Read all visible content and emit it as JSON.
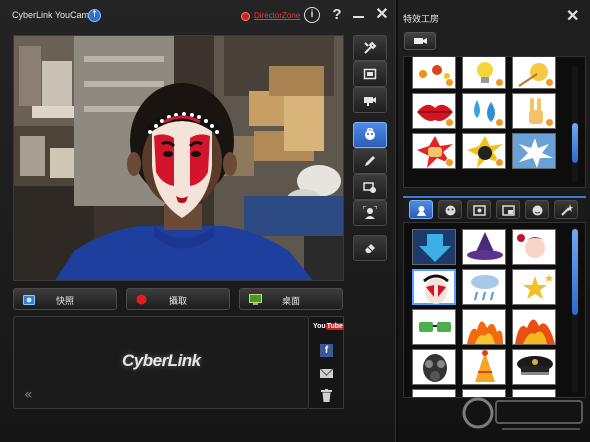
{
  "window": {
    "app_title": "CyberLink YouCam",
    "director_zone": "DirectorZone",
    "help_glyph": "?",
    "info_glyph": "i",
    "close_glyph": "✕"
  },
  "toolbar": {
    "icons": [
      "tools-icon",
      "fullscreen-icon",
      "camera-settings-icon",
      "avatar-effect-icon",
      "pen-icon",
      "scene-icon",
      "face-tracking-icon",
      "eraser-icon"
    ],
    "active": "avatar-effect-icon"
  },
  "capture": {
    "snapshot_label": "快照",
    "record_label": "攝取",
    "desktop_label": "桌面"
  },
  "library": {
    "logo_text": "CyberLink",
    "collapse_glyph": "«",
    "youtube_label_a": "You",
    "youtube_label_b": "Tube",
    "facebook_glyph": "f"
  },
  "effects_panel": {
    "title": "特效工房",
    "close_glyph": "✕",
    "top_grid_items": [
      "fire-sparks",
      "lightbulb",
      "sparkler",
      "lips",
      "water-drops",
      "peace-hand",
      "fist-punch",
      "bomb",
      "comic-burst"
    ],
    "category_tabs": [
      "avatar-tab",
      "emotion-tab",
      "frame-tab",
      "scene-tab",
      "face-tab",
      "magic-tab"
    ],
    "active_category": "avatar-tab",
    "bottom_grid_items": [
      "download-arrow",
      "witch-hat",
      "anime-girl",
      "opera-mask",
      "rain-cloud",
      "stars",
      "money-glasses",
      "fire",
      "flames",
      "gas-mask",
      "party-hat",
      "police-cap"
    ],
    "selected_item": "opera-mask"
  },
  "colors": {
    "accent": "#3a7ad8",
    "record_red": "#e02020",
    "director_zone_red": "#e23b3b",
    "badge_orange": "#f29a1d"
  }
}
